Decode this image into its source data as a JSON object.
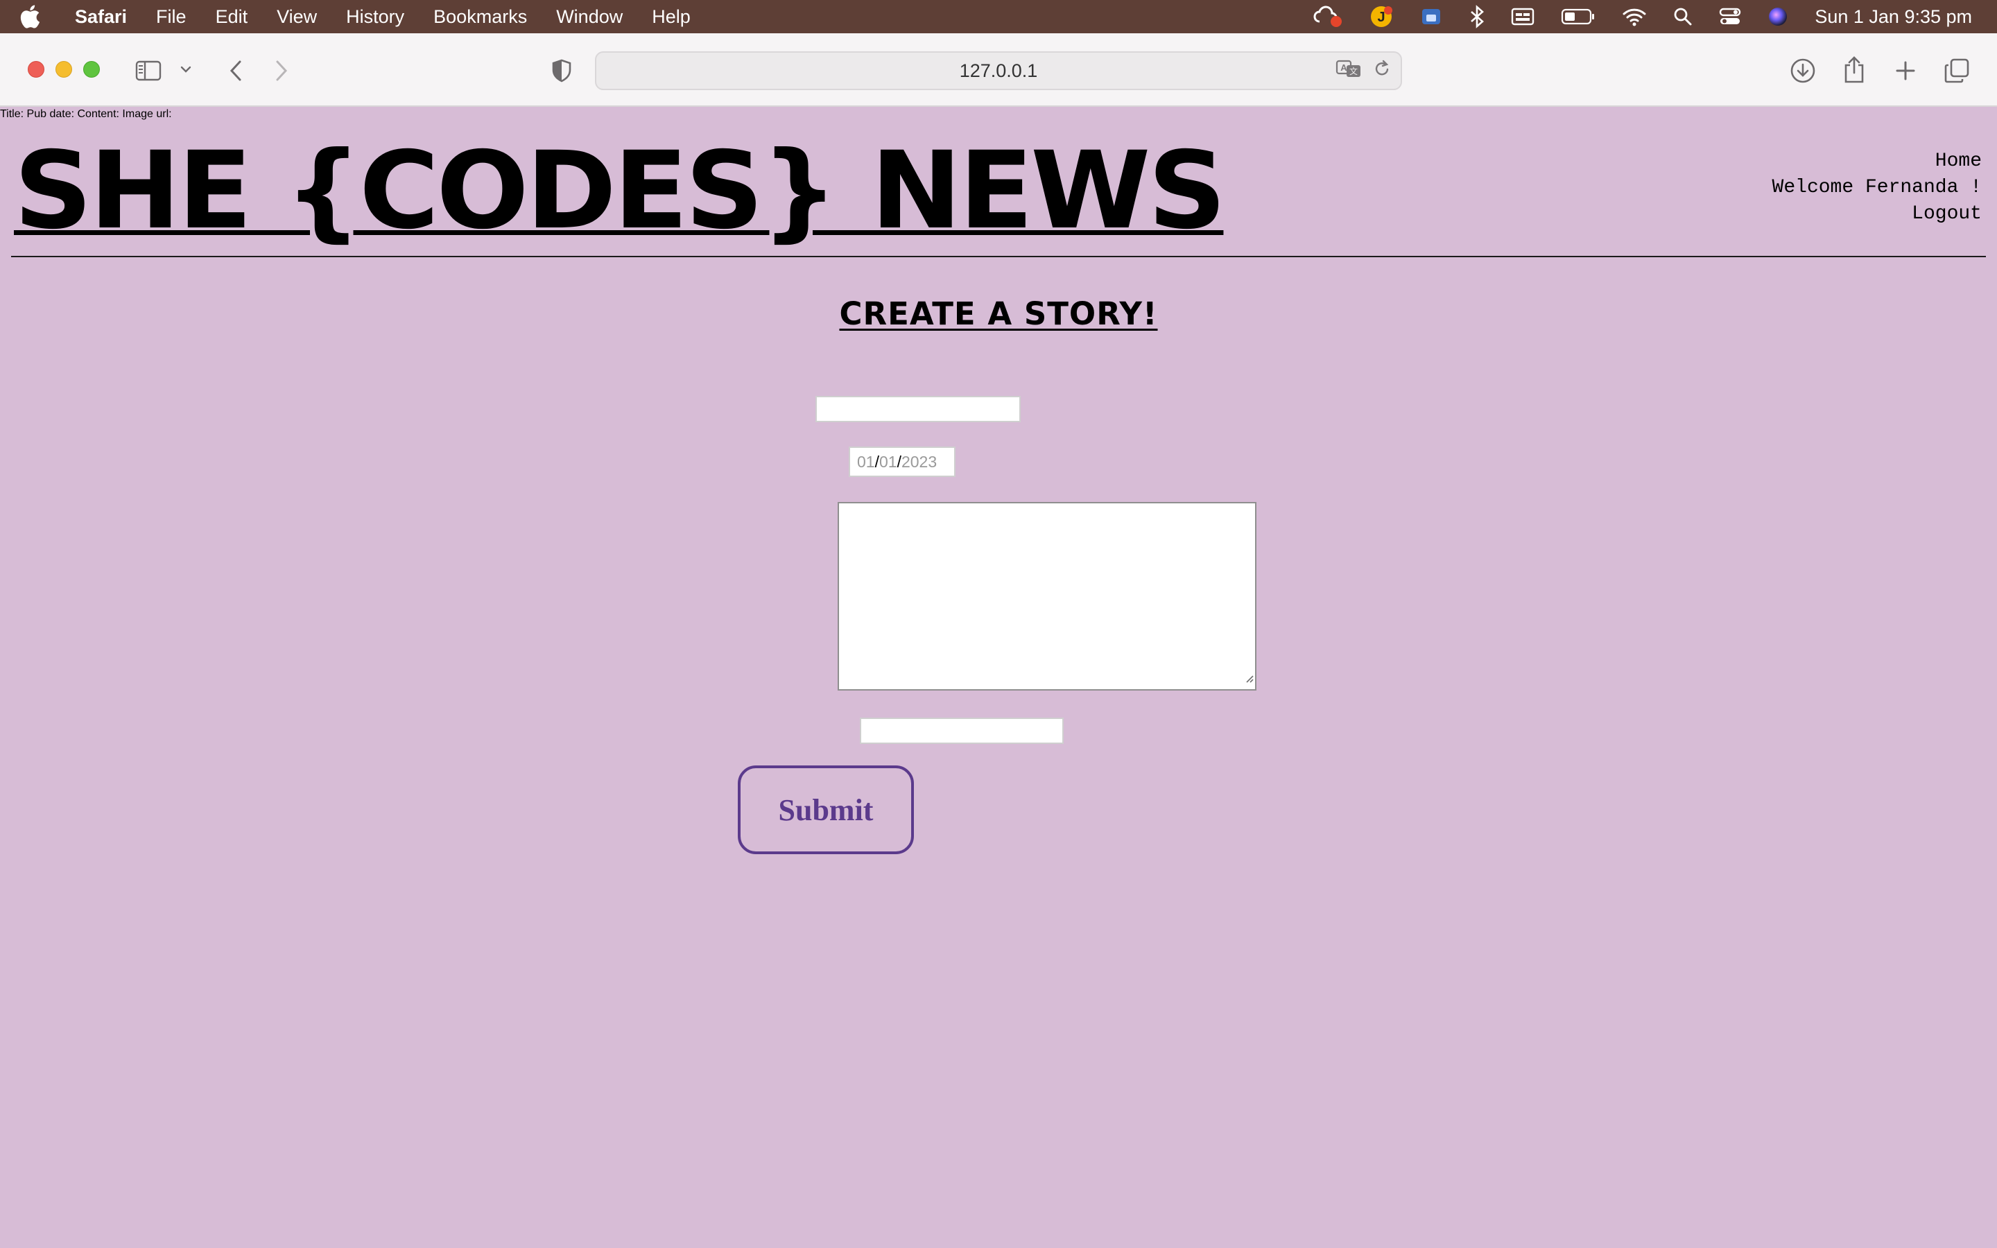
{
  "menubar": {
    "app_name": "Safari",
    "items": [
      "File",
      "Edit",
      "View",
      "History",
      "Bookmarks",
      "Window",
      "Help"
    ],
    "clock": "Sun 1 Jan  9:35 pm"
  },
  "browser": {
    "url": "127.0.0.1"
  },
  "site": {
    "title": "SHE {CODES} NEWS",
    "nav": {
      "home": "Home",
      "welcome": "Welcome Fernanda !",
      "logout": "Logout"
    }
  },
  "form": {
    "heading": "CREATE A STORY!",
    "title_label": "Title:",
    "title_value": "",
    "pub_date_label": "Pub date:",
    "pub_date": {
      "day": "01",
      "month": "01",
      "year": "2023"
    },
    "content_label": "Content:",
    "content_value": "",
    "image_url_label": "Image url:",
    "image_url_value": "",
    "submit_label": "Submit"
  },
  "colors": {
    "page_background": "#d7bcd6",
    "menubar_background": "#5e3f36",
    "submit_accent": "#5b3a8c"
  }
}
